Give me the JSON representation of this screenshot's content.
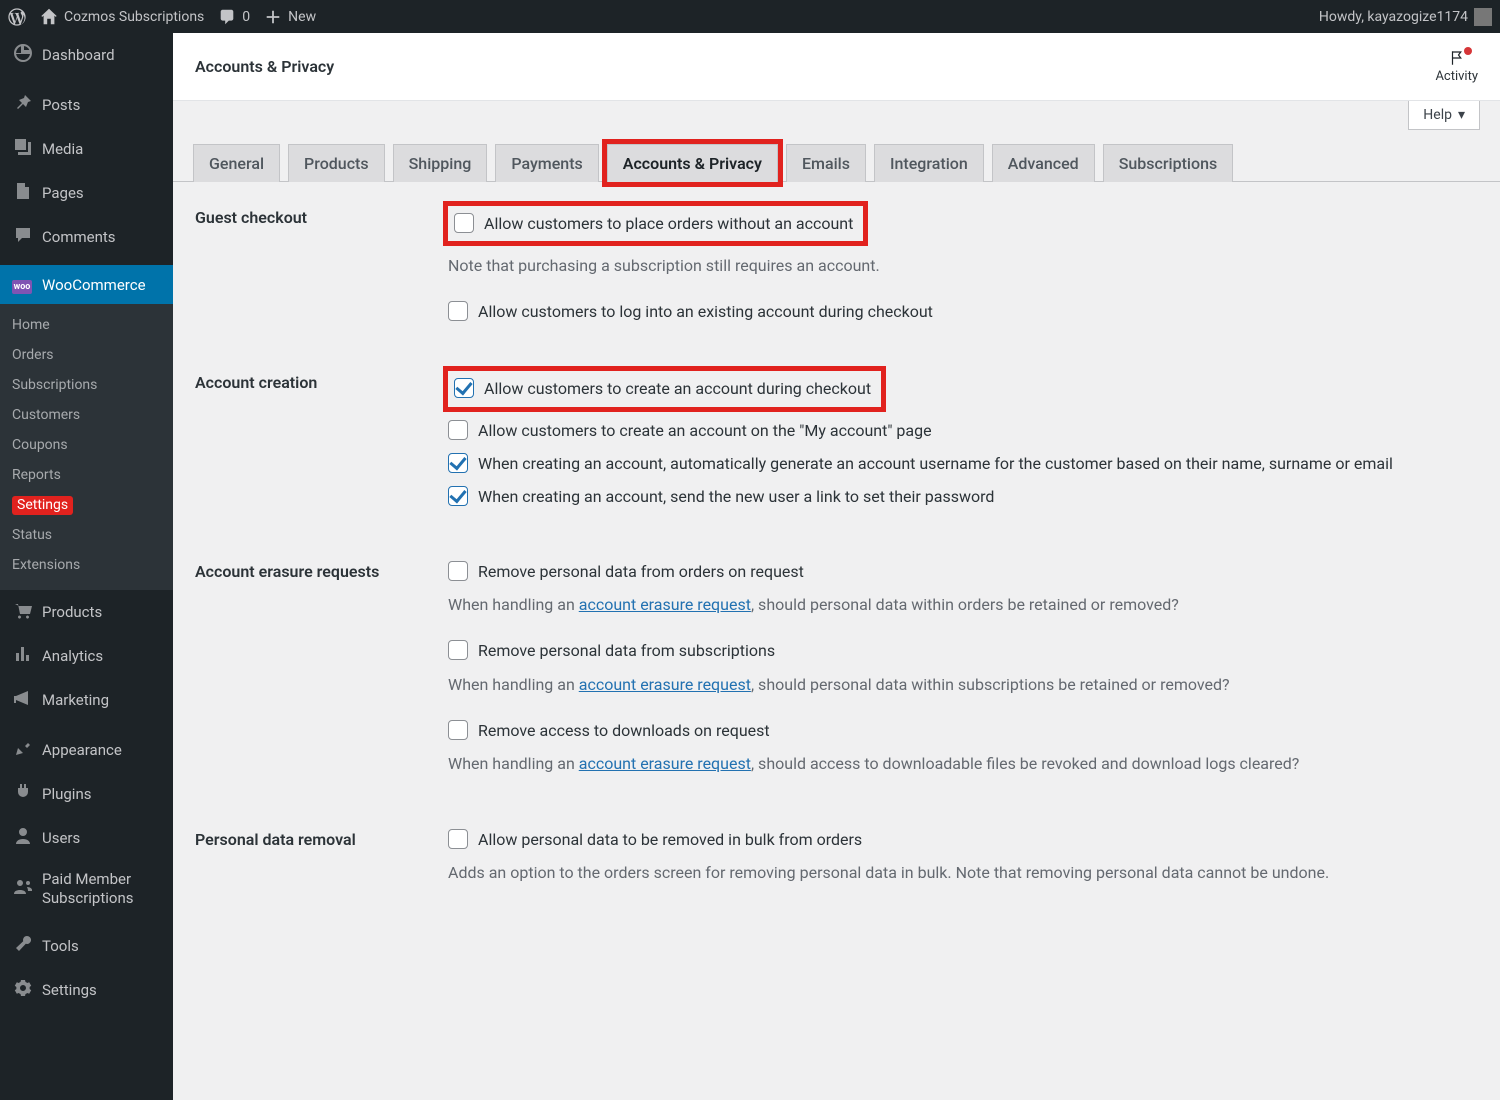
{
  "adminbar": {
    "site": "Cozmos Subscriptions",
    "comments": "0",
    "new": "New",
    "howdy": "Howdy, kayazogize1174"
  },
  "sidebar": {
    "top": [
      {
        "id": "dashboard",
        "label": "Dashboard"
      },
      {
        "id": "posts",
        "label": "Posts"
      },
      {
        "id": "media",
        "label": "Media"
      },
      {
        "id": "pages",
        "label": "Pages"
      },
      {
        "id": "comments",
        "label": "Comments"
      },
      {
        "id": "woocommerce",
        "label": "WooCommerce"
      },
      {
        "id": "products",
        "label": "Products"
      },
      {
        "id": "analytics",
        "label": "Analytics"
      },
      {
        "id": "marketing",
        "label": "Marketing"
      },
      {
        "id": "appearance",
        "label": "Appearance"
      },
      {
        "id": "plugins",
        "label": "Plugins"
      },
      {
        "id": "users",
        "label": "Users"
      },
      {
        "id": "paidmember",
        "label": "Paid Member Subscriptions"
      },
      {
        "id": "tools",
        "label": "Tools"
      },
      {
        "id": "settings",
        "label": "Settings"
      }
    ],
    "wc_sub": [
      {
        "label": "Home"
      },
      {
        "label": "Orders"
      },
      {
        "label": "Subscriptions"
      },
      {
        "label": "Customers"
      },
      {
        "label": "Coupons"
      },
      {
        "label": "Reports"
      },
      {
        "label": "Settings",
        "active": true
      },
      {
        "label": "Status"
      },
      {
        "label": "Extensions"
      }
    ]
  },
  "page": {
    "title": "Accounts & Privacy",
    "activity": "Activity",
    "help": "Help"
  },
  "tabs": [
    "General",
    "Products",
    "Shipping",
    "Payments",
    "Accounts & Privacy",
    "Emails",
    "Integration",
    "Advanced",
    "Subscriptions"
  ],
  "activeTab": "Accounts & Privacy",
  "sections": {
    "guest": {
      "heading": "Guest checkout",
      "opt1": "Allow customers to place orders without an account",
      "opt1_desc": "Note that purchasing a subscription still requires an account.",
      "opt2": "Allow customers to log into an existing account during checkout"
    },
    "creation": {
      "heading": "Account creation",
      "opt1": "Allow customers to create an account during checkout",
      "opt2": "Allow customers to create an account on the \"My account\" page",
      "opt3": "When creating an account, automatically generate an account username for the customer based on their name, surname or email",
      "opt4": "When creating an account, send the new user a link to set their password"
    },
    "erasure": {
      "heading": "Account erasure requests",
      "opt1": "Remove personal data from orders on request",
      "opt1_desc_pre": "When handling an ",
      "opt1_link": "account erasure request",
      "opt1_desc_post": ", should personal data within orders be retained or removed?",
      "opt2": "Remove personal data from subscriptions",
      "opt2_desc_post": ", should personal data within subscriptions be retained or removed?",
      "opt3": "Remove access to downloads on request",
      "opt3_desc_post": ", should access to downloadable files be revoked and download logs cleared?"
    },
    "removal": {
      "heading": "Personal data removal",
      "opt1": "Allow personal data to be removed in bulk from orders",
      "opt1_desc": "Adds an option to the orders screen for removing personal data in bulk. Note that removing personal data cannot be undone."
    }
  }
}
